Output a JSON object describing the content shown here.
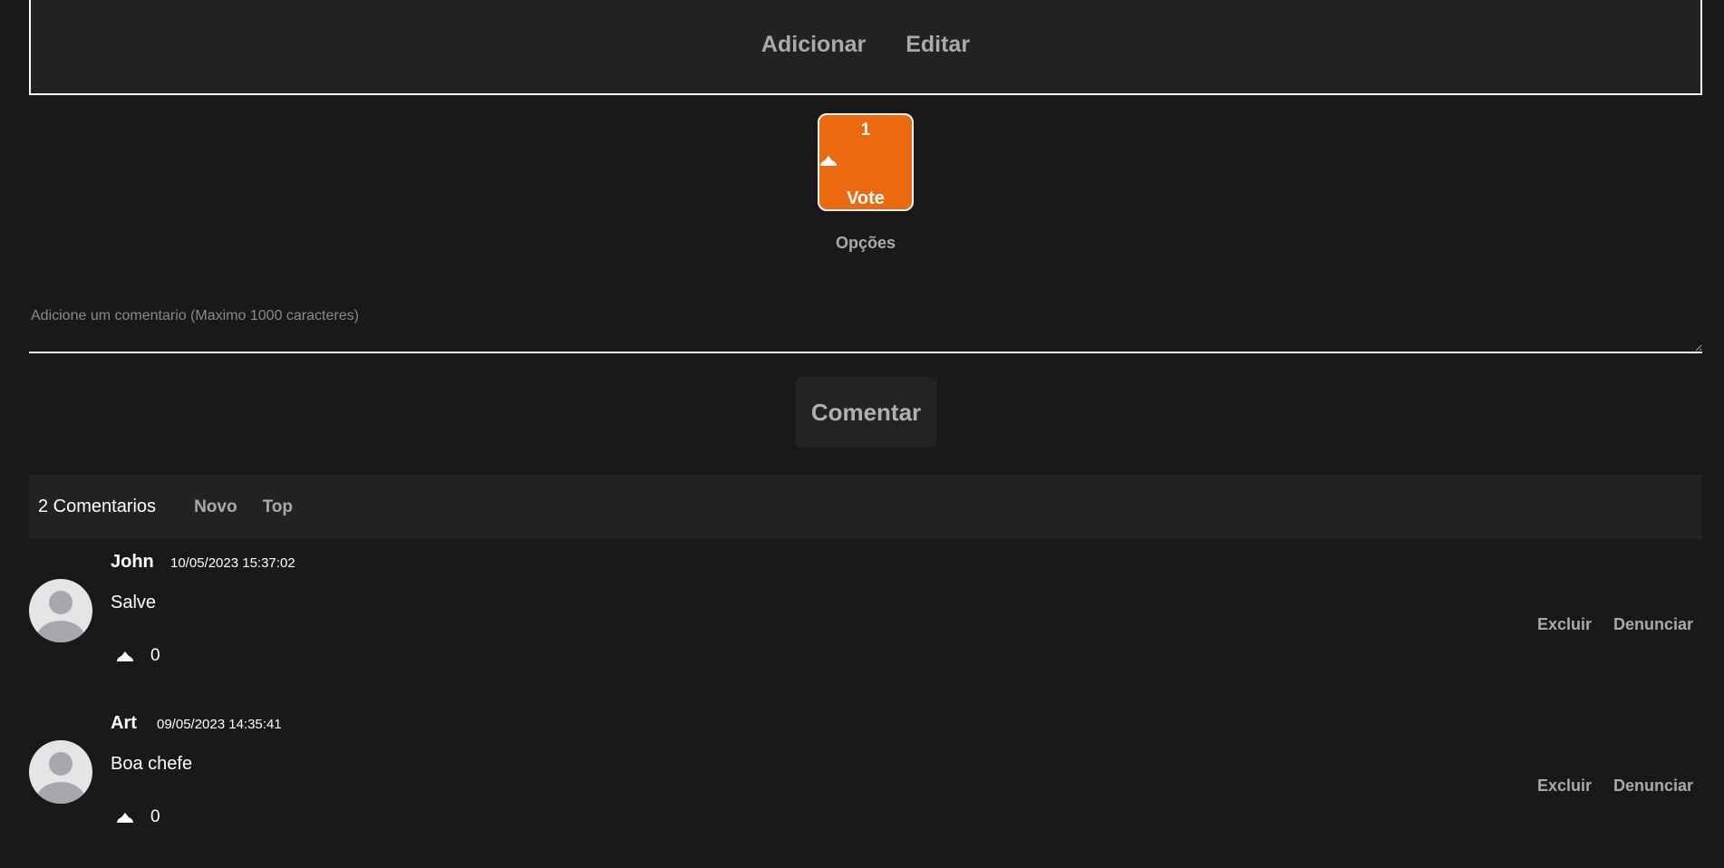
{
  "header": {
    "nav": [
      "Adicionar",
      "Editar"
    ]
  },
  "vote": {
    "count": "1",
    "label": "Vote",
    "accent": "#ec6a0f"
  },
  "options_label": "Opções",
  "comment_form": {
    "placeholder": "Adicione um comentario (Maximo 1000 caracteres)",
    "value": "",
    "submit_label": "Comentar"
  },
  "comments_bar": {
    "count_label": "2 Comentarios",
    "sort_new": "Novo",
    "sort_top": "Top"
  },
  "comments": [
    {
      "author": "John",
      "timestamp": "10/05/2023 15:37:02",
      "text": "Salve",
      "upvotes": "0",
      "delete_label": "Excluir",
      "report_label": "Denunciar"
    },
    {
      "author": "Art",
      "timestamp": "09/05/2023 14:35:41",
      "text": "Boa chefe",
      "upvotes": "0",
      "delete_label": "Excluir",
      "report_label": "Denunciar"
    }
  ],
  "icons": {
    "vote_arrow": "cloud-up-icon",
    "upvote": "cloud-up-icon",
    "avatar": "default-user-avatar-icon"
  }
}
